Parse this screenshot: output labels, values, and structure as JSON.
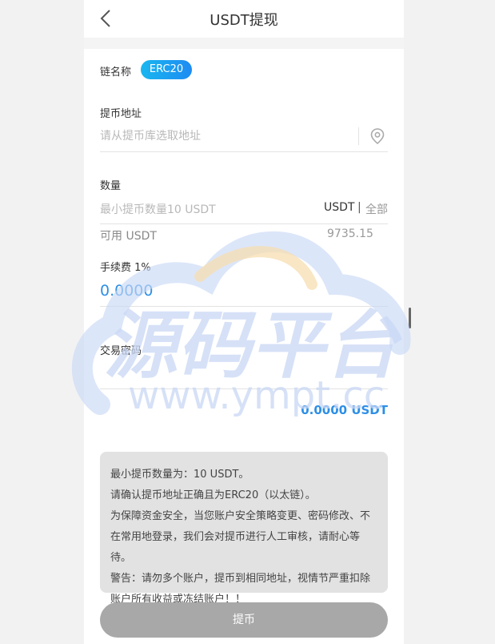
{
  "header": {
    "title": "USDT提现"
  },
  "form": {
    "chain_label": "链名称",
    "chain_value": "ERC20",
    "address_label": "提币地址",
    "address_placeholder": "请从提币库选取地址",
    "amount_label": "数量",
    "amount_placeholder": "最小提币数量10 USDT",
    "amount_unit": "USDT",
    "separator": "|",
    "all_label": "全部",
    "available_label": "可用 USDT",
    "available_value": "9735.15",
    "fee_label": "手续费 1%",
    "fee_value": "0.0000",
    "password_label": "交易密码",
    "total": "0.0000 USDT"
  },
  "notice": {
    "lines": [
      "最小提币数量为：10 USDT。",
      "请确认提币地址正确且为ERC20（以太链）。",
      "为保障资金安全，当您账户安全策略变更、密码修改、不在常用地登录，我们会对提币进行人工审核，请耐心等待。",
      "警告：请勿多个账户，提币到相同地址，视情节严重扣除账户所有收益或冻结账户！！"
    ]
  },
  "actions": {
    "submit_label": "提币"
  },
  "watermark": {
    "brand": "源码平台",
    "url": "www.ympt.cc"
  },
  "colors": {
    "accent": "#2d8fe6",
    "pill_gradient_start": "#19b7f0",
    "pill_gradient_end": "#1e8bf2",
    "button_disabled": "#a8a8a8"
  }
}
